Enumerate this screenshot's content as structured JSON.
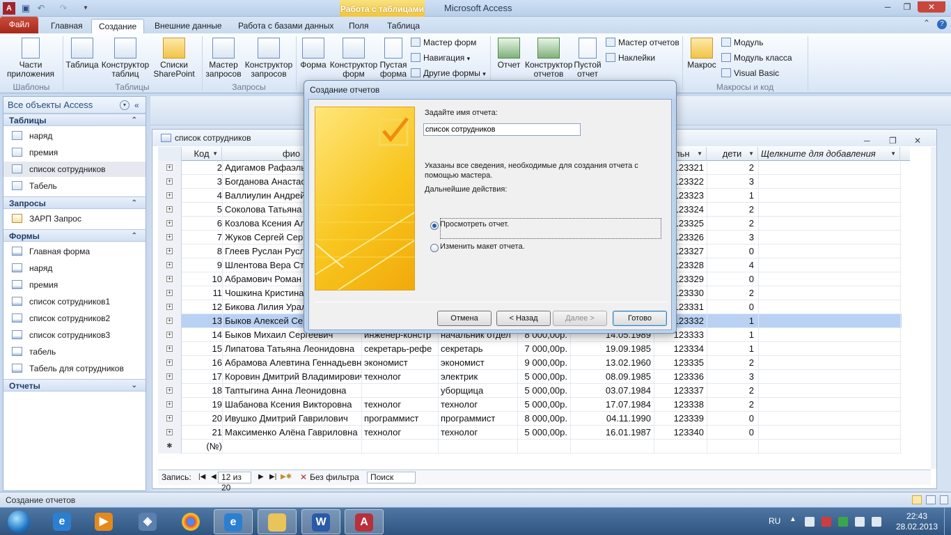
{
  "window": {
    "contextual_tab_group": "Работа с таблицами",
    "app_title": "Microsoft Access"
  },
  "tabs": {
    "file": "Файл",
    "home": "Главная",
    "create": "Создание",
    "external": "Внешние данные",
    "database_tools": "Работа с базами данных",
    "fields": "Поля",
    "table": "Таблица"
  },
  "ribbon": {
    "app_parts": [
      "Части",
      "приложения"
    ],
    "table": "Таблица",
    "table_designer": [
      "Конструктор",
      "таблиц"
    ],
    "sharepoint_lists": [
      "Списки",
      "SharePoint"
    ],
    "query_wizard": [
      "Мастер",
      "запросов"
    ],
    "query_designer": [
      "Конструктор",
      "запросов"
    ],
    "form": "Форма",
    "form_designer": [
      "Конструктор",
      "форм"
    ],
    "blank_form": [
      "Пустая",
      "форма"
    ],
    "form_wizard": "Мастер форм",
    "navigation": "Навигация",
    "more_forms": "Другие формы",
    "report": "Отчет",
    "report_designer": [
      "Конструктор",
      "отчетов"
    ],
    "blank_report": [
      "Пустой",
      "отчет"
    ],
    "report_wizard": "Мастер отчетов",
    "labels": "Наклейки",
    "macro": "Макрос",
    "module": "Модуль",
    "class_module": "Модуль класса",
    "visual_basic": "Visual Basic",
    "groups": {
      "templates": "Шаблоны",
      "tables": "Таблицы",
      "queries": "Запросы",
      "macros": "Макросы и код"
    }
  },
  "nav": {
    "header": "Все объекты Access",
    "groups": [
      {
        "title": "Таблицы",
        "items": [
          "наряд",
          "премия",
          "список сотрудников",
          "Табель"
        ]
      },
      {
        "title": "Запросы",
        "items": [
          "ЗАРП Запрос"
        ]
      },
      {
        "title": "Формы",
        "items": [
          "Главная форма",
          "наряд",
          "премия",
          "список сотрудников1",
          "список сотрудников2",
          "список сотрудников3",
          "табель",
          "Табель для сотрудников"
        ]
      },
      {
        "title": "Отчеты",
        "items": []
      }
    ]
  },
  "table_window": {
    "title": "список сотрудников",
    "headers": {
      "id": "Код",
      "name": "фио",
      "tab": "льн",
      "kids": "дети",
      "add": "Щелкните для добавления"
    },
    "rows": [
      {
        "id": "2",
        "name": "Адигамов Рафаэль",
        "c3": "",
        "c4": "",
        "c5": "",
        "c6": "",
        "tab": "123321",
        "kids": "2"
      },
      {
        "id": "3",
        "name": "Богданова Анастас",
        "c3": "",
        "c4": "",
        "c5": "",
        "c6": "",
        "tab": "123322",
        "kids": "3"
      },
      {
        "id": "4",
        "name": "Валлиулин Андрей",
        "c3": "",
        "c4": "",
        "c5": "",
        "c6": "",
        "tab": "123323",
        "kids": "1"
      },
      {
        "id": "5",
        "name": "Соколова Татьяна",
        "c3": "",
        "c4": "",
        "c5": "",
        "c6": "",
        "tab": "123324",
        "kids": "2"
      },
      {
        "id": "6",
        "name": "Козлова Ксения Ал",
        "c3": "",
        "c4": "",
        "c5": "",
        "c6": "",
        "tab": "123325",
        "kids": "2"
      },
      {
        "id": "7",
        "name": "Жуков Сергей Сер",
        "c3": "",
        "c4": "",
        "c5": "",
        "c6": "",
        "tab": "123326",
        "kids": "3"
      },
      {
        "id": "8",
        "name": "Глеев Руслан Русл",
        "c3": "",
        "c4": "",
        "c5": "",
        "c6": "",
        "tab": "123327",
        "kids": "0"
      },
      {
        "id": "9",
        "name": "Шлентова Вера Ст",
        "c3": "",
        "c4": "",
        "c5": "",
        "c6": "",
        "tab": "123328",
        "kids": "4"
      },
      {
        "id": "10",
        "name": "Абрамович Роман",
        "c3": "",
        "c4": "",
        "c5": "",
        "c6": "",
        "tab": "123329",
        "kids": "0"
      },
      {
        "id": "11",
        "name": "Чошкина Кристина",
        "c3": "",
        "c4": "",
        "c5": "",
        "c6": "",
        "tab": "123330",
        "kids": "2"
      },
      {
        "id": "12",
        "name": "Бикова Лилия Урал",
        "c3": "",
        "c4": "",
        "c5": "",
        "c6": "",
        "tab": "123331",
        "kids": "0"
      },
      {
        "id": "13",
        "name": "Быков Алексей Се",
        "c3": "",
        "c4": "",
        "c5": "",
        "c6": "",
        "tab": "123332",
        "kids": "1"
      },
      {
        "id": "14",
        "name": "Быков Михаил Сергеевич",
        "c3": "инженер-констр",
        "c4": "начальник отдел",
        "c5": "8 000,00р.",
        "c6": "14.05.1989",
        "tab": "123333",
        "kids": "1"
      },
      {
        "id": "15",
        "name": "Липатова Татьяна Леонидовна",
        "c3": "секретарь-рефе",
        "c4": "секретарь",
        "c5": "7 000,00р.",
        "c6": "19.09.1985",
        "tab": "123334",
        "kids": "1"
      },
      {
        "id": "16",
        "name": "Абрамова Алевтина Геннадьевна",
        "c3": "экономист",
        "c4": "экономист",
        "c5": "9 000,00р.",
        "c6": "13.02.1960",
        "tab": "123335",
        "kids": "2"
      },
      {
        "id": "17",
        "name": "Коровин Дмитрий Владимирович",
        "c3": "технолог",
        "c4": "электрик",
        "c5": "5 000,00р.",
        "c6": "08.09.1985",
        "tab": "123336",
        "kids": "3"
      },
      {
        "id": "18",
        "name": "Таптыгина Анна Леонидовна",
        "c3": "",
        "c4": "уборщица",
        "c5": "5 000,00р.",
        "c6": "03.07.1984",
        "tab": "123337",
        "kids": "2"
      },
      {
        "id": "19",
        "name": "Шабанова Ксения Викторовна",
        "c3": "технолог",
        "c4": "технолог",
        "c5": "5 000,00р.",
        "c6": "17.07.1984",
        "tab": "123338",
        "kids": "2"
      },
      {
        "id": "20",
        "name": "Ивушко Дмитрий Гаврилович",
        "c3": "программист",
        "c4": "программист",
        "c5": "8 000,00р.",
        "c6": "04.11.1990",
        "tab": "123339",
        "kids": "0"
      },
      {
        "id": "21",
        "name": "Максименко Алёна Гавриловна",
        "c3": "технолог",
        "c4": "технолог",
        "c5": "5 000,00р.",
        "c6": "16.01.1987",
        "tab": "123340",
        "kids": "0"
      }
    ],
    "new_row_id": "(№)",
    "record_label": "Запись:",
    "record_position": "12 из 20",
    "filter_label": "Без фильтра",
    "search_placeholder": "Поиск"
  },
  "dialog": {
    "title": "Создание отчетов",
    "prompt": "Задайте имя отчета:",
    "report_name": "список сотрудников",
    "info": "Указаны все сведения, необходимые для создания отчета с помощью мастера.",
    "next_actions": "Дальнейшие действия:",
    "option_preview": "Просмотреть отчет.",
    "option_modify": "Изменить макет отчета.",
    "cancel": "Отмена",
    "back": "< Назад",
    "next": "Далее >",
    "finish": "Готово"
  },
  "status_bar": {
    "text": "Создание отчетов"
  },
  "taskbar": {
    "lang": "RU",
    "time": "22:43",
    "date": "28.02.2013"
  }
}
